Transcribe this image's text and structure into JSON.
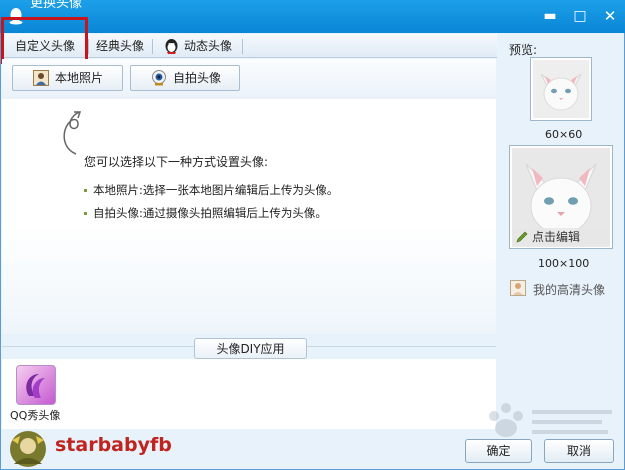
{
  "window": {
    "title": "更换头像",
    "minimize_glyph": "▬",
    "maximize_glyph": "□",
    "close_glyph": "✕"
  },
  "tabs": [
    {
      "label": "自定义头像",
      "active": true
    },
    {
      "label": "经典头像",
      "active": false
    },
    {
      "label": "动态头像",
      "active": false,
      "icon": "animated-penguin-icon"
    }
  ],
  "toolbar": {
    "local_photo_label": "本地照片",
    "local_photo_icon": "portrait-icon",
    "selfie_label": "自拍头像",
    "selfie_icon": "webcam-icon"
  },
  "hint": {
    "title": "您可以选择以下一种方式设置头像:",
    "bullets": [
      "本地照片:选择一张本地图片编辑后上传为头像。",
      "自拍头像:通过摄像头拍照编辑后上传为头像。"
    ]
  },
  "diy": {
    "tab_label": "头像DIY应用",
    "apps": [
      {
        "label": "QQ秀头像",
        "icon": "qq-show-icon"
      }
    ]
  },
  "preview": {
    "label": "预览:",
    "small_size": "60×60",
    "large_size": "100×100",
    "edit_label": "点击编辑",
    "hd_label": "我的高清头像"
  },
  "dialog": {
    "ok_label": "确定",
    "cancel_label": "取消"
  },
  "watermark": {
    "author": "starbabyfb"
  },
  "colors": {
    "titlebar": "#0a86d6",
    "highlight_box": "#c8141c",
    "watermark_text": "#c0241e"
  }
}
